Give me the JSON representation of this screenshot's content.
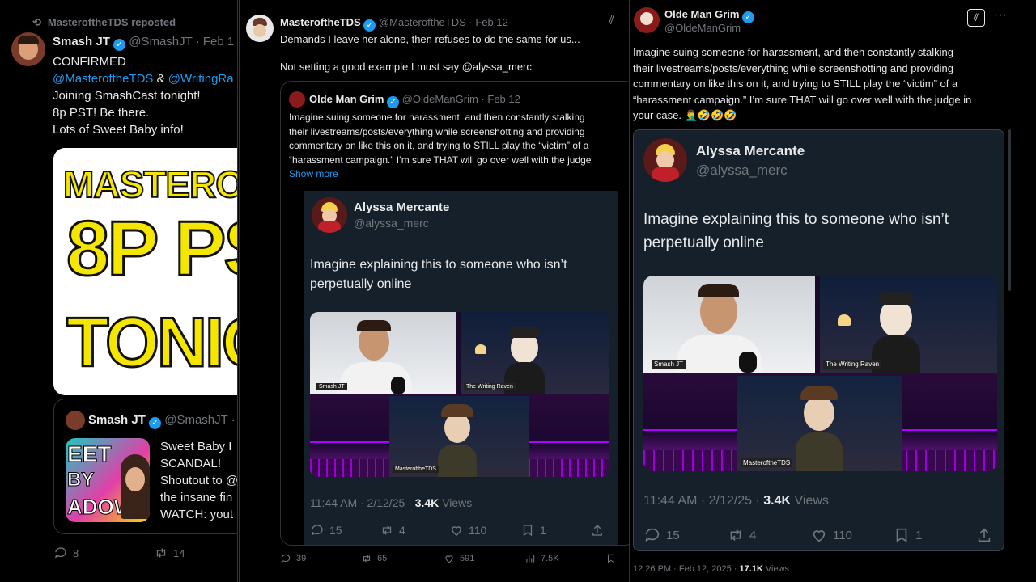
{
  "left": {
    "repost_line": "MasteroftheTDS reposted",
    "author_name": "Smash JT",
    "author_handle": "@SmashJT · Feb 1",
    "lines": [
      "CONFIRMED"
    ],
    "mention1": "@MasteroftheTDS",
    "amp": "&",
    "mention2": "@WritingRa",
    "lines2": [
      "Joining SmashCast tonight!",
      "8p PST! Be there.",
      "Lots of Sweet Baby info!"
    ],
    "banner": [
      "MASTEROFT",
      "8P PS",
      "TONIGH"
    ],
    "quote": {
      "name": "Smash JT",
      "handle": "@SmashJT ·",
      "lines": [
        "Sweet Baby I",
        "SCANDAL!",
        "Shoutout to @",
        "the insane fin",
        "WATCH: yout"
      ],
      "thumb_text": [
        "EET",
        "BY",
        "ADOWS"
      ]
    },
    "replies": "8",
    "reposts": "14"
  },
  "middle": {
    "author_name": "MasteroftheTDS",
    "author_handle": "@MasteroftheTDS · Feb 12",
    "line1": "Demands I leave her alone, then refuses to do the same for us...",
    "line2": "Not setting a good example I must say @alyssa_merc",
    "quote": {
      "name": "Olde Man Grim",
      "handle": "@OldeManGrim · Feb 12",
      "lines": [
        "Imagine suing someone for harassment, and then constantly stalking",
        "their livestreams/posts/everything while screenshotting and providing",
        "commentary on like this on it, and trying to STILL play the “victim” of a",
        "“harassment campaign.” I’m sure THAT will go over well with the judge"
      ],
      "show_more": "Show more"
    },
    "inner": {
      "name": "Alyssa Mercante",
      "handle": "@alyssa_merc",
      "lines": [
        "Imagine explaining this to someone who isn’t",
        "perpetually online"
      ],
      "labels": [
        "Smash JT",
        "The Writing Raven",
        "MasteroftheTDS"
      ],
      "time": "11:44 AM · 2/12/25 ·",
      "views_count": "3.4K",
      "views_label": "Views",
      "replies": "15",
      "reposts": "4",
      "likes": "110",
      "bookmarks": "1"
    },
    "replies": "39",
    "reposts": "65",
    "likes": "591",
    "views": "7.5K"
  },
  "right": {
    "author_name": "Olde Man Grim",
    "author_handle": "@OldeManGrim",
    "lines": [
      "Imagine suing someone for harassment, and then constantly stalking",
      "their livestreams/posts/everything while screenshotting and providing",
      "commentary on like this on it, and trying to STILL play the “victim” of a",
      "“harassment campaign.” I’m sure THAT will go over well with the judge in",
      "your case. 🤦‍♂️🤣🤣🤣"
    ],
    "inner": {
      "name": "Alyssa Mercante",
      "handle": "@alyssa_merc",
      "lines": [
        "Imagine explaining this to someone who isn’t",
        "perpetually online"
      ],
      "labels": [
        "Smash JT",
        "The Writing Raven",
        "MasteroftheTDS"
      ],
      "time": "11:44 AM · 2/12/25 ·",
      "views_count": "3.4K",
      "views_label": "Views",
      "replies": "15",
      "reposts": "4",
      "likes": "110",
      "bookmarks": "1"
    },
    "footer_time": "12:26 PM · Feb 12, 2025 ·",
    "footer_views": "17.1K",
    "footer_views_label": "Views"
  },
  "colors": {
    "accent": "#1d9bf0",
    "banner_yellow": "#f5e600",
    "neon_purple": "#b000ff"
  }
}
